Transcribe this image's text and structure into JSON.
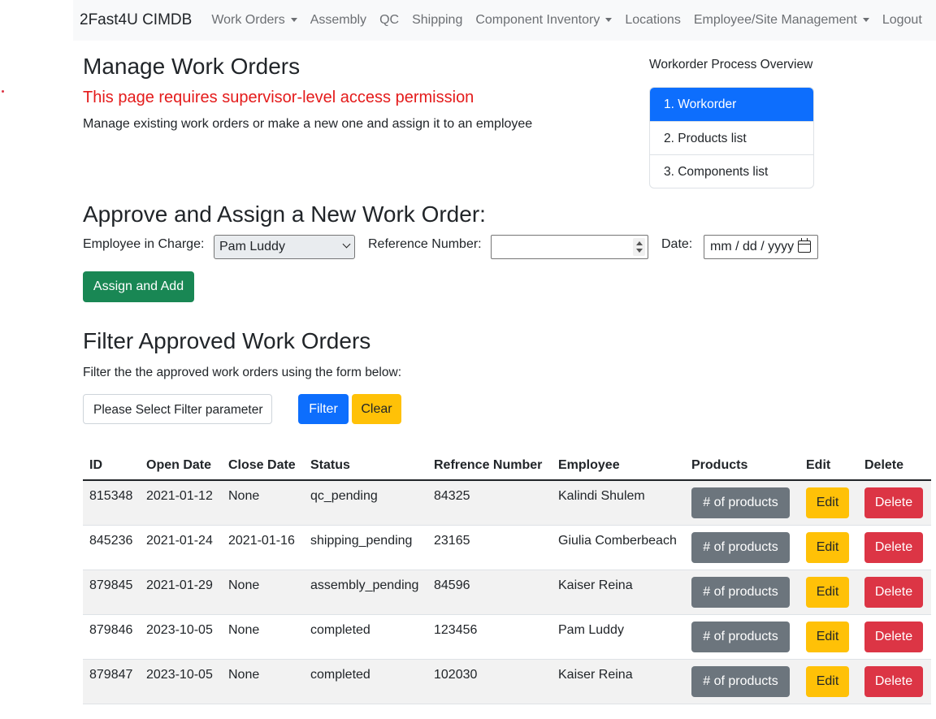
{
  "navbar": {
    "brand": "2Fast4U CIMDB",
    "items": [
      {
        "label": "Work Orders",
        "dropdown": true
      },
      {
        "label": "Assembly",
        "dropdown": false
      },
      {
        "label": "QC",
        "dropdown": false
      },
      {
        "label": "Shipping",
        "dropdown": false
      },
      {
        "label": "Component Inventory",
        "dropdown": true
      },
      {
        "label": "Locations",
        "dropdown": false
      },
      {
        "label": "Employee/Site Management",
        "dropdown": true
      },
      {
        "label": "Logout",
        "dropdown": false
      }
    ]
  },
  "page": {
    "title": "Manage Work Orders",
    "permission_warning": "This page requires supervisor-level access permission",
    "description": "Manage existing work orders or make a new one and assign it to an employee"
  },
  "process": {
    "title": "Workorder Process Overview",
    "steps": [
      "1. Workorder",
      "2. Products list",
      "3. Components list"
    ],
    "active_index": 0
  },
  "assign": {
    "title": "Approve and Assign a New Work Order:",
    "employee_label": "Employee in Charge:",
    "employee_value": "Pam Luddy",
    "reference_label": "Reference Number:",
    "reference_value": "",
    "date_label": "Date:",
    "date_placeholder": "mm / dd / yyyy",
    "submit_label": "Assign and Add"
  },
  "filter": {
    "title": "Filter Approved Work Orders",
    "description": "Filter the the approved work orders using the form below:",
    "select_placeholder": "Please Select Filter parameter",
    "filter_label": "Filter",
    "clear_label": "Clear"
  },
  "table": {
    "headers": [
      "ID",
      "Open Date",
      "Close Date",
      "Status",
      "Refrence Number",
      "Employee",
      "Products",
      "Edit",
      "Delete"
    ],
    "products_button": "# of products",
    "edit_button": "Edit",
    "delete_button": "Delete",
    "rows": [
      {
        "id": "815348",
        "open": "2021-01-12",
        "close": "None",
        "status": "qc_pending",
        "ref": "84325",
        "employee": "Kalindi Shulem"
      },
      {
        "id": "845236",
        "open": "2021-01-24",
        "close": "2021-01-16",
        "status": "shipping_pending",
        "ref": "23165",
        "employee": "Giulia Comberbeach"
      },
      {
        "id": "879845",
        "open": "2021-01-29",
        "close": "None",
        "status": "assembly_pending",
        "ref": "84596",
        "employee": "Kaiser Reina"
      },
      {
        "id": "879846",
        "open": "2023-10-05",
        "close": "None",
        "status": "completed",
        "ref": "123456",
        "employee": "Pam Luddy"
      },
      {
        "id": "879847",
        "open": "2023-10-05",
        "close": "None",
        "status": "completed",
        "ref": "102030",
        "employee": "Kaiser Reina"
      }
    ]
  },
  "colors": {
    "primary": "#0d6efd",
    "success": "#198754",
    "warning": "#ffc107",
    "danger": "#dc3545",
    "secondary": "#6c757d",
    "alert_text": "#e41b1b"
  }
}
